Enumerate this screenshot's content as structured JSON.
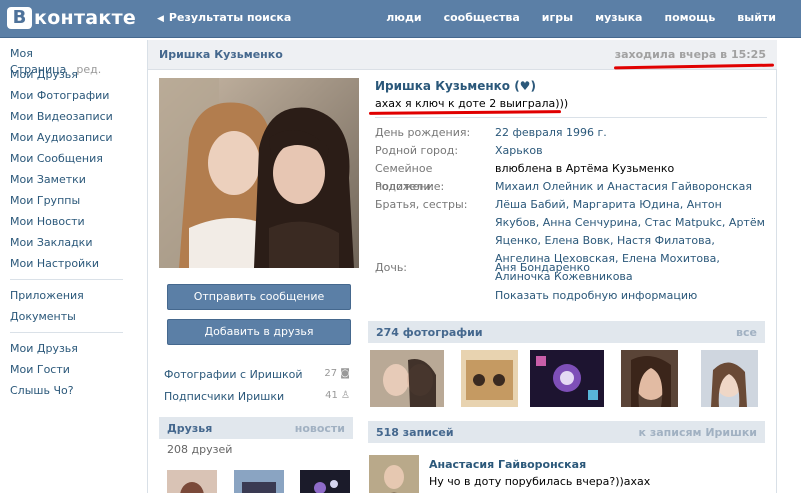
{
  "header": {
    "logo_letter": "В",
    "logo_word": "контакте",
    "back_label": "Результаты поиска",
    "nav": [
      "люди",
      "сообщества",
      "игры",
      "музыка",
      "помощь",
      "выйти"
    ]
  },
  "left_menu": {
    "group1": [
      "Моя Страница",
      "Мои Друзья",
      "Мои Фотографии",
      "Мои Видеозаписи",
      "Мои Аудиозаписи",
      "Мои Сообщения",
      "Мои Заметки",
      "Мои Группы",
      "Мои Новости",
      "Мои Закладки",
      "Мои Настройки"
    ],
    "edit_label": "ред.",
    "group2": [
      "Приложения",
      "Документы"
    ],
    "group3": [
      "Мои Друзья",
      "Мои Гости",
      "Слышь Чо?"
    ]
  },
  "profile": {
    "title_name": "Иришка Кузьменко",
    "online": "заходила вчера в 15:25",
    "name": "Иришка Кузьменко (♥)",
    "status": "ахах я ключ к доте 2 выиграла)))",
    "send_message": "Отправить сообщение",
    "add_friend": "Добавить в друзья",
    "photos_with": "Фотографии с Иришкой",
    "photos_with_count": "27",
    "subscribers": "Подписчики Иришки",
    "subscribers_count": "41",
    "info": [
      {
        "label": "День рождения:",
        "value": "22 февраля 1996 г."
      },
      {
        "label": "Родной город:",
        "value": "Харьков"
      },
      {
        "label": "Семейное положение:",
        "value": "влюблена в Артёма Кузьменко"
      },
      {
        "label": "Родители:",
        "value": "Михаил Олейник и Анастасия Гайворонская"
      },
      {
        "label": "Братья, сестры:",
        "value": "Лёша Бабий, Маргарита Юдина, Антон Якубов, Анна Сенчурина, Стас Matpukc, Артём Яценко, Елена Вовк, Настя Филатова, Ангелина Цеховская, Елена Мохитова, Алиночка Кожевникова"
      },
      {
        "label": "Дочь:",
        "value": "Аня Бондаренко"
      }
    ],
    "more_info": "Показать подробную информацию"
  },
  "friends": {
    "title": "Друзья",
    "right": "новости",
    "count": "208 друзей"
  },
  "photos": {
    "title": "274 фотографии",
    "right": "все"
  },
  "wall": {
    "title": "518 записей",
    "right": "к записям Иришки",
    "post_author": "Анастасия Гайворонская",
    "post_text": "Ну чо в доту порубилась вчера?))ахах"
  },
  "colors": {
    "header": "#5b7fa6",
    "link": "#2b587a",
    "section_head": "#e1e7ed",
    "annotation_red": "#e00000"
  }
}
